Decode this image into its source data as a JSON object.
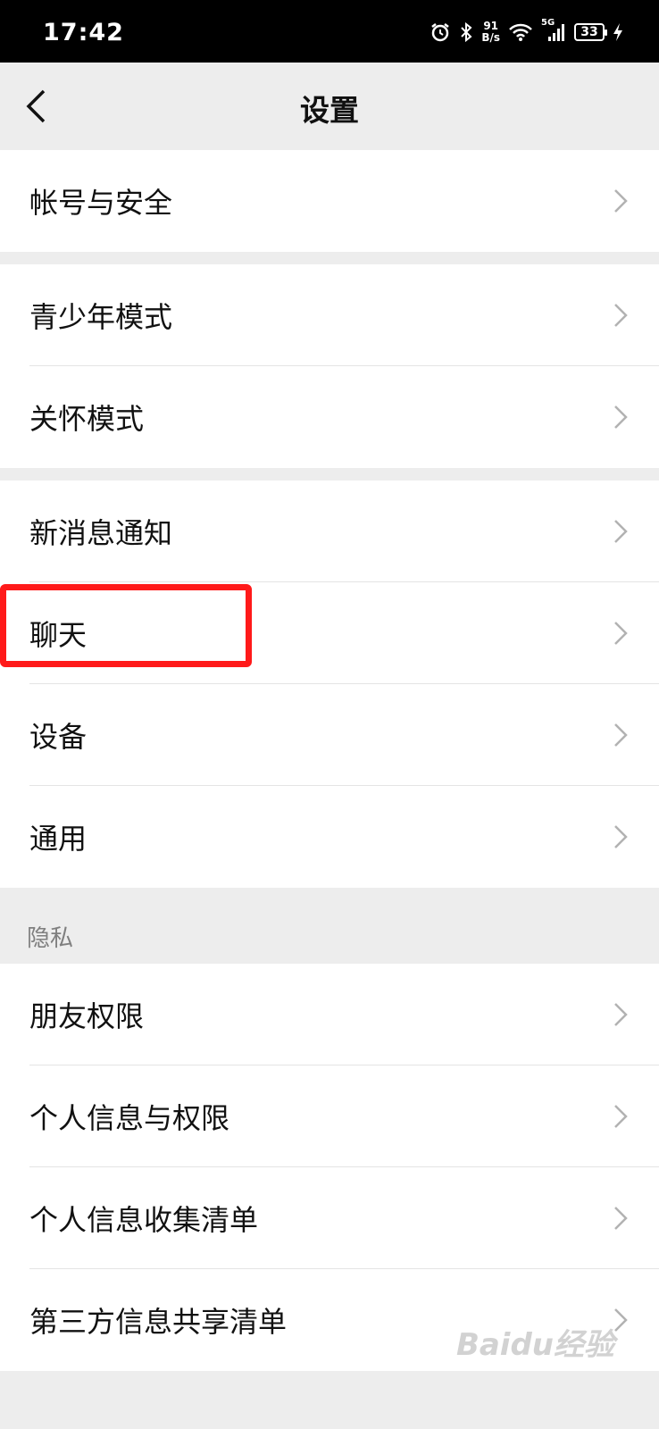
{
  "status_bar": {
    "time": "17:42",
    "net_speed_value": "91",
    "net_speed_unit": "B/s",
    "signal_label": "5G",
    "battery": "33",
    "icons": [
      "alarm-icon",
      "bluetooth-icon",
      "wifi-icon",
      "signal-icon",
      "battery-icon",
      "charging-icon"
    ]
  },
  "nav": {
    "title": "设置"
  },
  "groups": {
    "account": [
      "帐号与安全"
    ],
    "modes": [
      "青少年模式",
      "关怀模式"
    ],
    "general": [
      "新消息通知",
      "聊天",
      "设备",
      "通用"
    ],
    "privacy": [
      "朋友权限",
      "个人信息与权限",
      "个人信息收集清单",
      "第三方信息共享清单"
    ]
  },
  "sections": {
    "privacy_header": "隐私"
  },
  "highlight_color": "#ff1a1a",
  "watermark": "Baidu经验"
}
